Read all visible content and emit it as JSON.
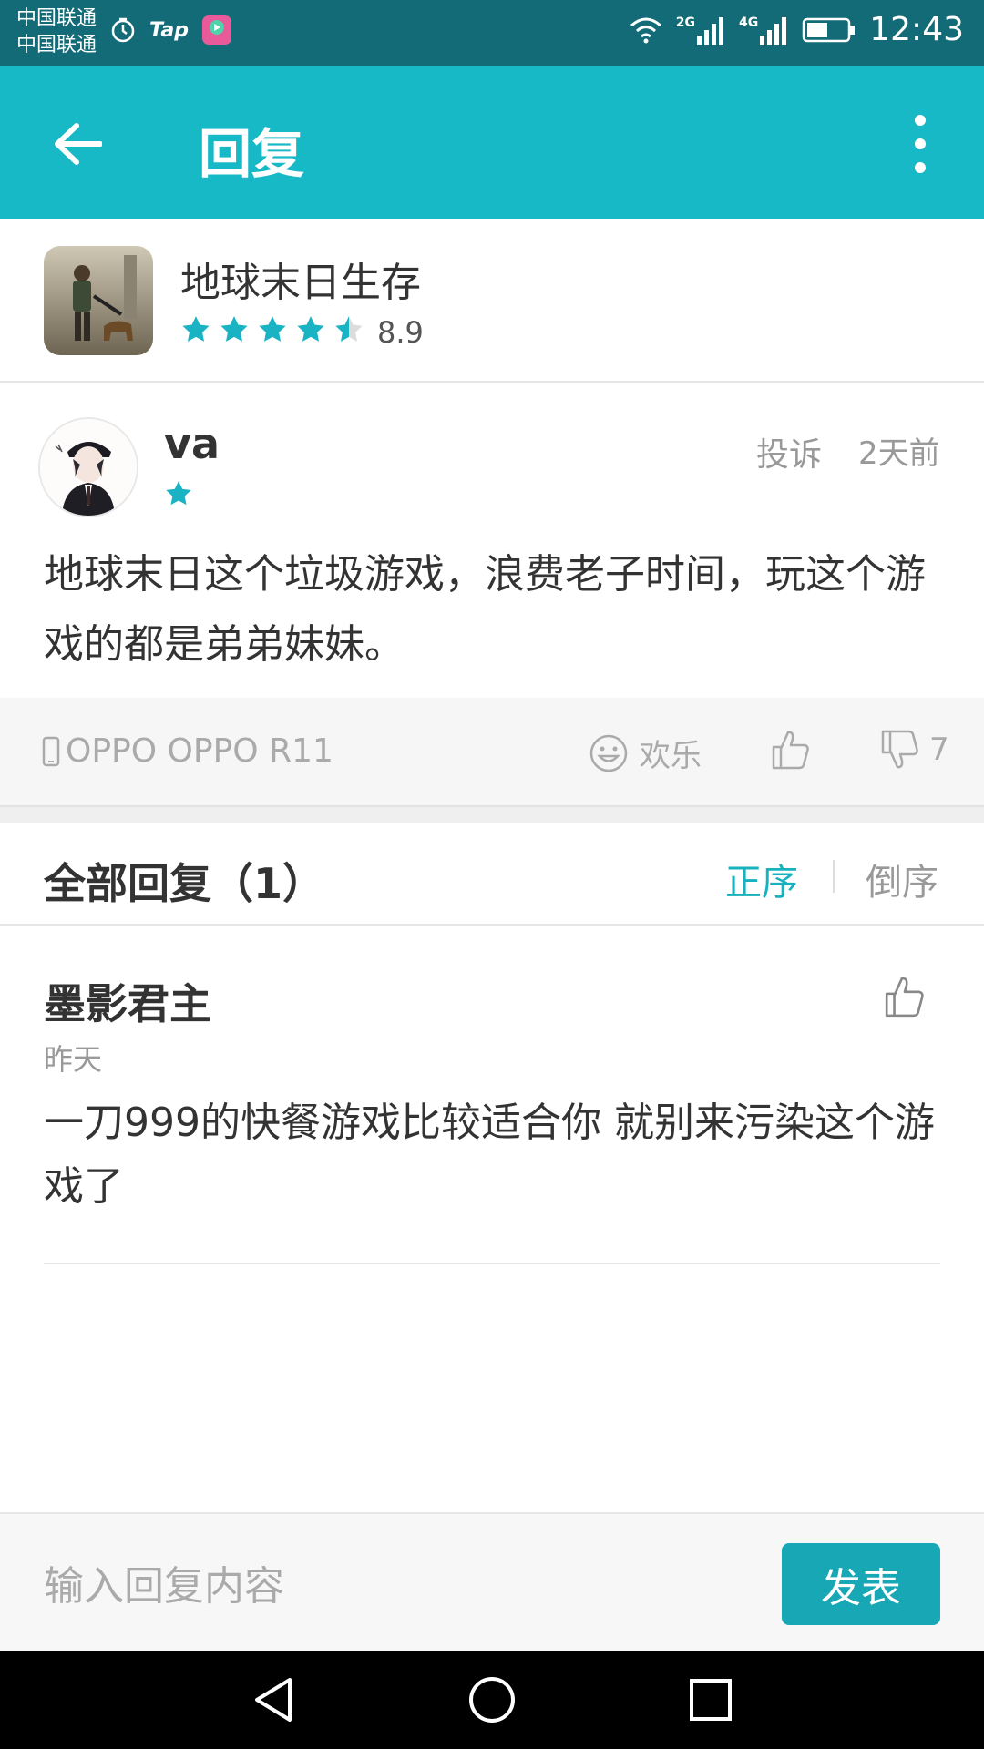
{
  "status_bar": {
    "carrier_1": "中国联通",
    "carrier_2": "中国联通",
    "tap_label": "Tap",
    "net_2g": "2G",
    "net_4g": "4G",
    "time": "12:43",
    "icons": [
      "alarm-icon",
      "tap-app-icon",
      "video-app-icon",
      "wifi-icon",
      "signal-icon",
      "battery-icon"
    ]
  },
  "app_bar": {
    "title": "回复",
    "icons": [
      "arrow-left-icon",
      "more-vert-icon"
    ]
  },
  "game": {
    "name": "地球末日生存",
    "rating": "8.9",
    "stars": 4.5
  },
  "review": {
    "username": "va",
    "user_stars": 1,
    "report_label": "投诉",
    "time": "2天前",
    "text": "地球末日这个垃圾游戏，浪费老子时间，玩这个游戏的都是弟弟妹妹。",
    "device": "OPPO OPPO R11",
    "mood": "欢乐",
    "dislike_count": "7"
  },
  "replies": {
    "title": "全部回复（1）",
    "sort_asc": "正序",
    "sort_desc": "倒序",
    "items": [
      {
        "username": "墨影君主",
        "time": "昨天",
        "text": "一刀999的快餐游戏比较适合你 就别来污染这个游戏了"
      }
    ]
  },
  "composer": {
    "placeholder": "输入回复内容",
    "submit_label": "发表"
  },
  "colors": {
    "accent": "#17b9c6",
    "status_bar": "#126b77",
    "button": "#17a7b5"
  }
}
